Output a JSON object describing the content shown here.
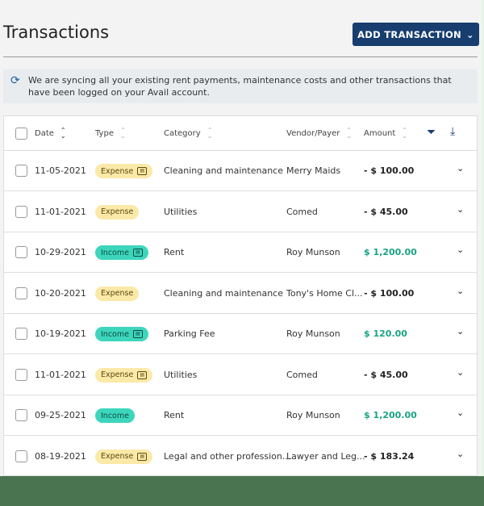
{
  "header": {
    "title": "Transactions",
    "add_button": "ADD TRANSACTION"
  },
  "sync_notice": "We are syncing all your existing rent payments, maintenance costs and other transactions that have been logged on your Avail account.",
  "columns": [
    "Date",
    "Type",
    "Category",
    "Vendor/Payer",
    "Amount"
  ],
  "rows": [
    {
      "date": "11-05-2021",
      "type": "Expense",
      "icon": true,
      "category": "Cleaning and maintenance",
      "vendor": "Merry Maids",
      "amount": "- $ 100.00"
    },
    {
      "date": "11-01-2021",
      "type": "Expense",
      "icon": false,
      "category": "Utilities",
      "vendor": "Comed",
      "amount": "- $ 45.00"
    },
    {
      "date": "10-29-2021",
      "type": "Income",
      "icon": true,
      "category": "Rent",
      "vendor": "Roy Munson",
      "amount": "$ 1,200.00"
    },
    {
      "date": "10-20-2021",
      "type": "Expense",
      "icon": false,
      "category": "Cleaning and maintenance",
      "vendor": "Tony's Home Cl...",
      "amount": "- $ 100.00"
    },
    {
      "date": "10-19-2021",
      "type": "Income",
      "icon": true,
      "category": "Parking Fee",
      "vendor": "Roy Munson",
      "amount": "$ 120.00"
    },
    {
      "date": "11-01-2021",
      "type": "Expense",
      "icon": true,
      "category": "Utilities",
      "vendor": "Comed",
      "amount": "- $ 45.00"
    },
    {
      "date": "09-25-2021",
      "type": "Income",
      "icon": false,
      "category": "Rent",
      "vendor": "Roy Munson",
      "amount": "$ 1,200.00"
    },
    {
      "date": "08-19-2021",
      "type": "Expense",
      "icon": true,
      "category": "Legal and other profession...",
      "vendor": "Lawyer and Leg...",
      "amount": "- $ 183.24"
    }
  ],
  "colors": {
    "primary": "#173e6e",
    "income": "#3dd6bd",
    "expense": "#fbe9a8",
    "positive_amount": "#1aa383"
  }
}
